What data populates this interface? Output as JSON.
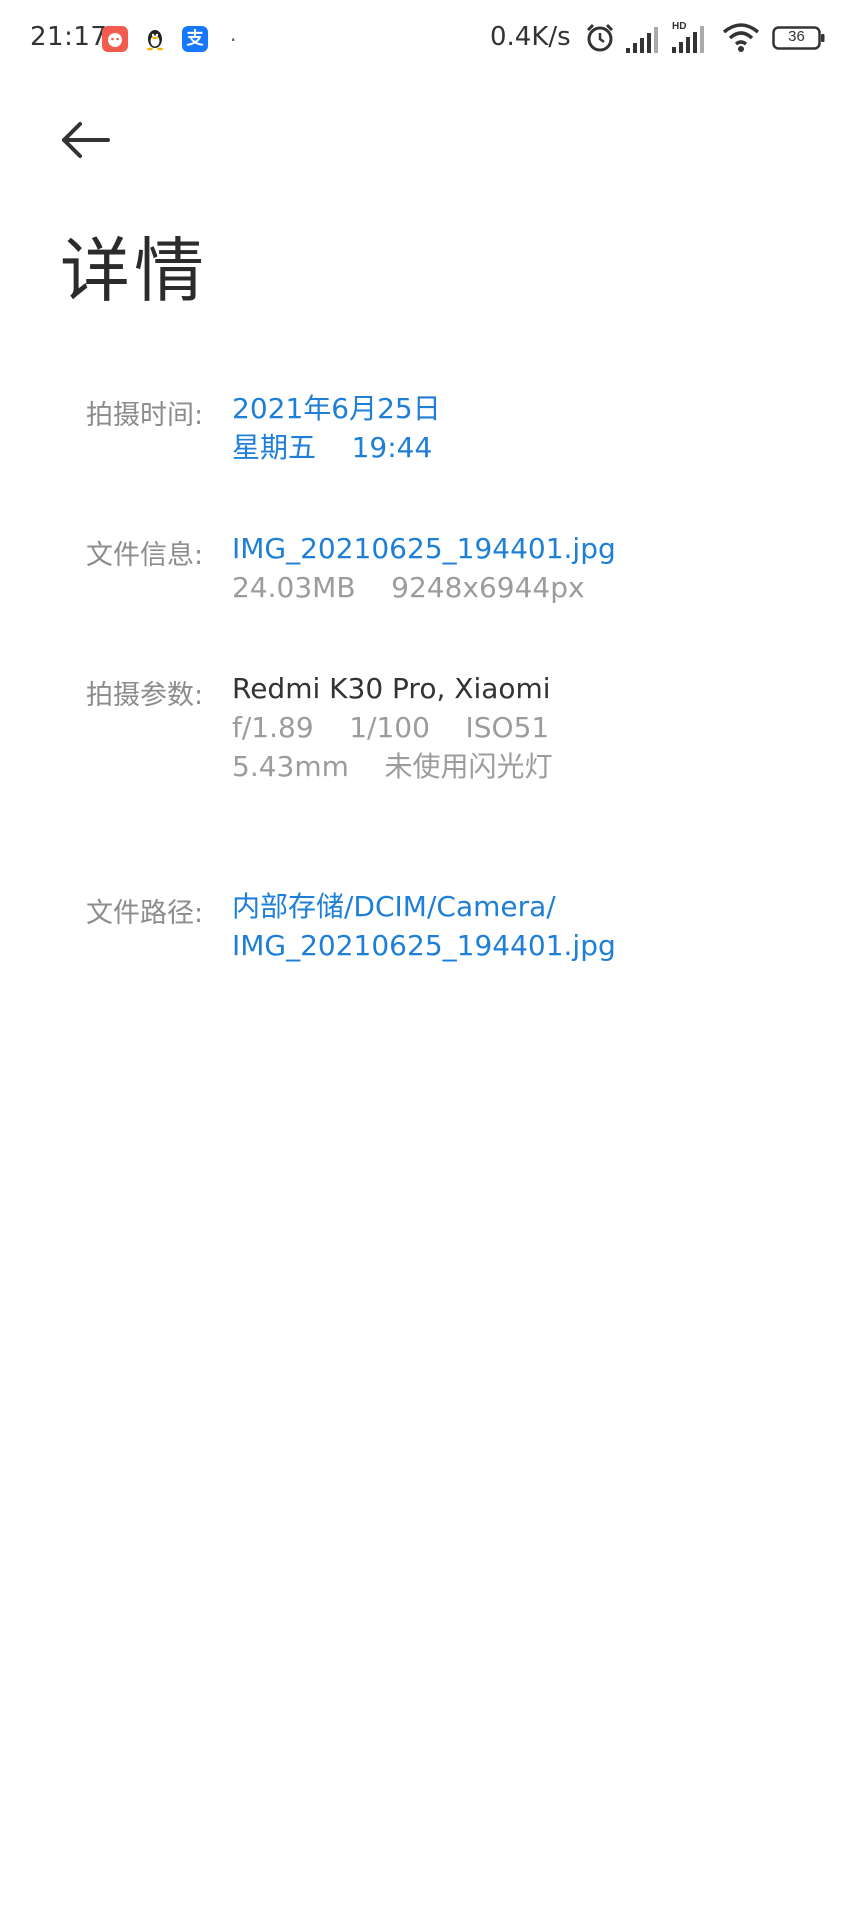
{
  "status_bar": {
    "time": "21:17",
    "app_icons": [
      {
        "name": "weibo-style-app-icon",
        "color": "#f25b4d"
      },
      {
        "name": "qq-penguin-icon",
        "color": "#222222"
      },
      {
        "name": "alipay-icon",
        "color": "#1677ff",
        "glyph": "支"
      }
    ],
    "dot": "·",
    "network_speed": "0.4K/s",
    "battery_level": "36"
  },
  "header": {
    "title": "详情"
  },
  "details": {
    "capture_time": {
      "label": "拍摄时间:",
      "date": "2021年6月25日",
      "weekday_time": "星期五    19:44"
    },
    "file_info": {
      "label": "文件信息:",
      "filename": "IMG_20210625_194401.jpg",
      "size_resolution": "24.03MB    9248x6944px"
    },
    "camera_params": {
      "label": "拍摄参数:",
      "device": "Redmi K30 Pro, Xiaomi",
      "exposure": "f/1.89    1/100    ISO51",
      "focal_flash": "5.43mm    未使用闪光灯"
    },
    "file_path": {
      "label": "文件路径:",
      "path_line1": "内部存储/DCIM/Camera/",
      "path_line2": "IMG_20210625_194401.jpg"
    }
  },
  "colors": {
    "link_blue": "#1f7fd6",
    "label_gray": "#8c8c8c",
    "secondary_gray": "#9c9c9c"
  }
}
